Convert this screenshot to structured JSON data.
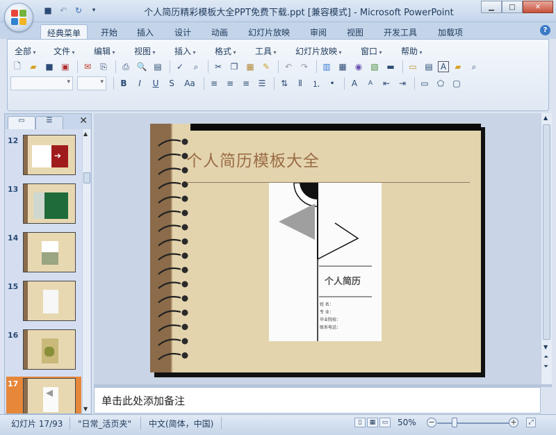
{
  "window": {
    "title": "个人简历精彩模板大全PPT免费下载.ppt [兼容模式] - Microsoft PowerPoint"
  },
  "ribbon_tabs": [
    {
      "label": "经典菜单",
      "active": true
    },
    {
      "label": "开始"
    },
    {
      "label": "插入"
    },
    {
      "label": "设计"
    },
    {
      "label": "动画"
    },
    {
      "label": "幻灯片放映"
    },
    {
      "label": "审阅"
    },
    {
      "label": "视图"
    },
    {
      "label": "开发工具"
    },
    {
      "label": "加载项"
    }
  ],
  "classic_menu": [
    "全部",
    "文件",
    "编辑",
    "视图",
    "插入",
    "格式",
    "工具",
    "幻灯片放映",
    "窗口",
    "帮助"
  ],
  "thumbnails": [
    {
      "number": "12"
    },
    {
      "number": "13"
    },
    {
      "number": "14"
    },
    {
      "number": "15"
    },
    {
      "number": "16"
    },
    {
      "number": "17",
      "selected": true
    }
  ],
  "slide": {
    "title": "个人简历模板大全",
    "picture": {
      "heading": "个人简历",
      "fields": [
        "姓      名：",
        "专      业：",
        "毕业院校：",
        "联系电话："
      ]
    }
  },
  "notes": {
    "placeholder": "单击此处添加备注"
  },
  "status": {
    "slide_info": "幻灯片 17/93",
    "theme": "\"日常_活页夹\"",
    "language": "中文(简体，中国)",
    "zoom": "50%"
  },
  "colors": {
    "slide_background": "#e3d4ae",
    "slide_title": "#9a6c45",
    "spine": "#8b6b4a",
    "selected_thumb": "#e6873a"
  }
}
